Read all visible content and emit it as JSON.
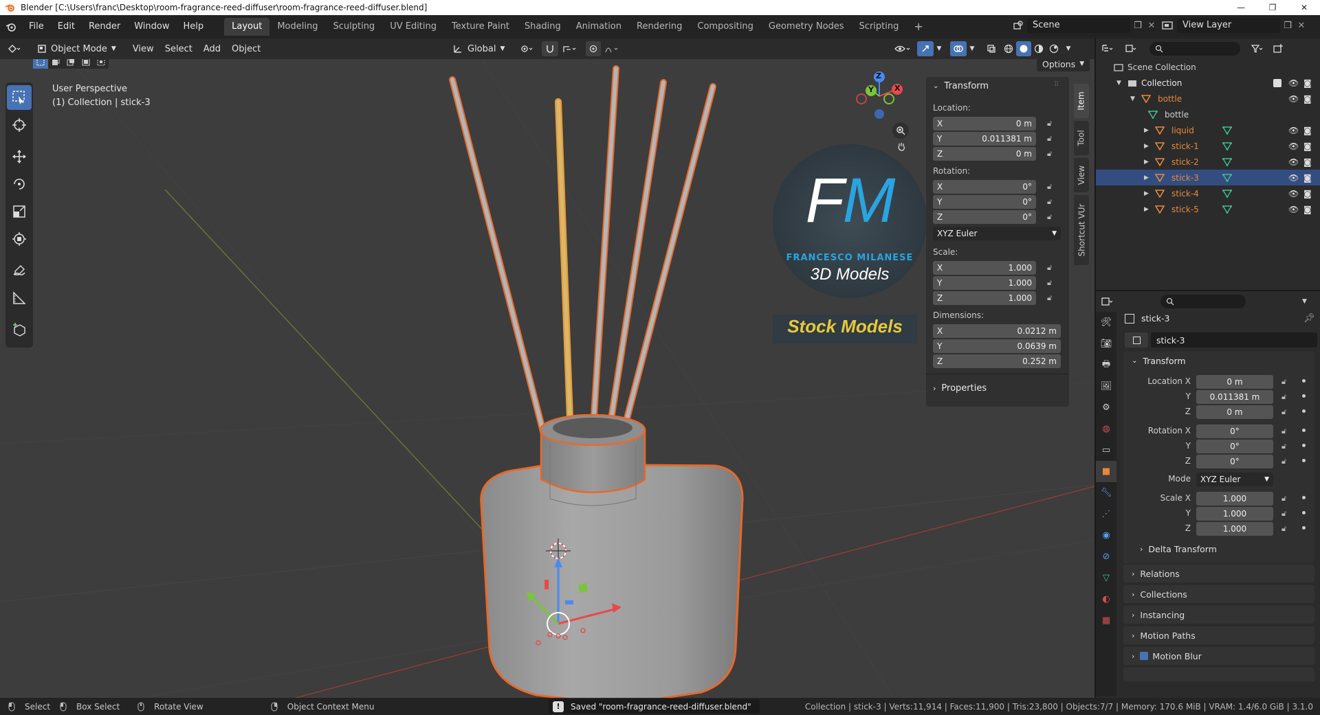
{
  "window": {
    "title": "Blender [C:\\Users\\franc\\Desktop\\room-fragrance-reed-diffuser\\room-fragrance-reed-diffuser.blend]",
    "minimize": "—",
    "maximize": "❐",
    "close": "✕"
  },
  "menu": {
    "items": [
      "File",
      "Edit",
      "Render",
      "Window",
      "Help"
    ]
  },
  "workspaces": {
    "tabs": [
      "Layout",
      "Modeling",
      "Sculpting",
      "UV Editing",
      "Texture Paint",
      "Shading",
      "Animation",
      "Rendering",
      "Compositing",
      "Geometry Nodes",
      "Scripting"
    ],
    "active": "Layout",
    "add": "+"
  },
  "scene": {
    "name": "Scene",
    "view_layer": "View Layer"
  },
  "header3d": {
    "mode": "Object Mode",
    "menus": [
      "View",
      "Select",
      "Add",
      "Object"
    ],
    "transform_orientation": "Global",
    "options": "Options"
  },
  "viewport": {
    "perspective": "User Perspective",
    "context": "(1) Collection | stick-3",
    "watermark": {
      "initials": "FM",
      "name": "FRANCESCO MILANESE",
      "subtitle": "3D Models",
      "banner": "Stock Models"
    },
    "gizmo": {
      "x": "X",
      "y": "Y",
      "z": "Z"
    }
  },
  "npanel": {
    "title": "Transform",
    "location_label": "Location:",
    "location": [
      {
        "axis": "X",
        "value": "0 m"
      },
      {
        "axis": "Y",
        "value": "0.011381 m"
      },
      {
        "axis": "Z",
        "value": "0 m"
      }
    ],
    "rotation_label": "Rotation:",
    "rotation": [
      {
        "axis": "X",
        "value": "0°"
      },
      {
        "axis": "Y",
        "value": "0°"
      },
      {
        "axis": "Z",
        "value": "0°"
      }
    ],
    "rotation_mode": "XYZ Euler",
    "scale_label": "Scale:",
    "scale": [
      {
        "axis": "X",
        "value": "1.000"
      },
      {
        "axis": "Y",
        "value": "1.000"
      },
      {
        "axis": "Z",
        "value": "1.000"
      }
    ],
    "dimensions_label": "Dimensions:",
    "dimensions": [
      {
        "axis": "X",
        "value": "0.0212 m"
      },
      {
        "axis": "Y",
        "value": "0.0639 m"
      },
      {
        "axis": "Z",
        "value": "0.252 m"
      }
    ],
    "properties": "Properties",
    "tabs": [
      "Item",
      "Tool",
      "View",
      "Shortcut VUr"
    ]
  },
  "outliner": {
    "scene_collection": "Scene Collection",
    "collection": "Collection",
    "items": [
      {
        "name": "bottle",
        "depth": 2,
        "kind": "object"
      },
      {
        "name": "bottle",
        "depth": 3,
        "kind": "mesh"
      },
      {
        "name": "liquid",
        "depth": 3,
        "kind": "object"
      },
      {
        "name": "stick-1",
        "depth": 3,
        "kind": "object"
      },
      {
        "name": "stick-2",
        "depth": 3,
        "kind": "object"
      },
      {
        "name": "stick-3",
        "depth": 3,
        "kind": "object",
        "selected": true
      },
      {
        "name": "stick-4",
        "depth": 3,
        "kind": "object"
      },
      {
        "name": "stick-5",
        "depth": 3,
        "kind": "object"
      }
    ]
  },
  "properties": {
    "object_name": "stick-3",
    "datablock": "stick-3",
    "transform": "Transform",
    "location_x_label": "Location X",
    "rotation_x_label": "Rotation X",
    "scale_x_label": "Scale X",
    "y_label": "Y",
    "z_label": "Z",
    "location": [
      "0 m",
      "0.011381 m",
      "0 m"
    ],
    "rotation": [
      "0°",
      "0°",
      "0°"
    ],
    "mode_label": "Mode",
    "mode": "XYZ Euler",
    "scale": [
      "1.000",
      "1.000",
      "1.000"
    ],
    "sections": [
      "Delta Transform",
      "Relations",
      "Collections",
      "Instancing",
      "Motion Paths",
      "Motion Blur"
    ]
  },
  "status": {
    "select": "Select",
    "box_select": "Box Select",
    "rotate": "Rotate View",
    "context_menu": "Object Context Menu",
    "saved": "Saved \"room-fragrance-reed-diffuser.blend\"",
    "stats": "Collection | stick-3 | Verts:11,914 | Faces:11,900 | Tris:23,800 | Objects:7/7 | Memory: 170.6 MiB | VRAM: 1.4/6.0 GiB | 3.1.0"
  },
  "colors": {
    "accent": "#4772b3",
    "selection_outline": "#e8692a",
    "object_orange": "#e8893a",
    "mesh_green": "#3fbf8f"
  }
}
